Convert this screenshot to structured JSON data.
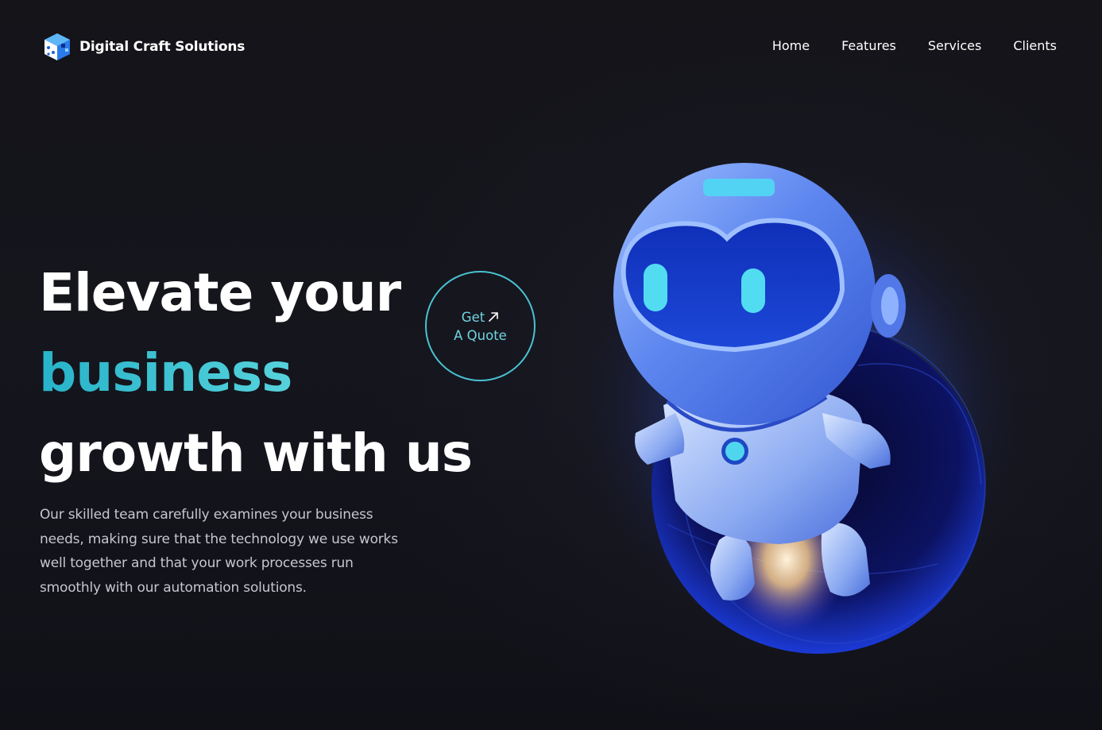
{
  "header": {
    "brand": "Digital Craft Solutions",
    "nav": [
      "Home",
      "Features",
      "Services",
      "Clients"
    ]
  },
  "hero": {
    "line1": "Elevate your",
    "line2": "business",
    "line3": "growth with us",
    "description": "Our skilled team carefully examines your business needs, making sure that the technology we use works well together and that your work processes run smoothly with our automation solutions.",
    "cta_line1": "Get",
    "cta_line2": "A Quote"
  },
  "colors": {
    "accent": "#49c3d3",
    "background": "#13131b",
    "robot_blue": "#3a6df0"
  },
  "icons": [
    "cube-logo-icon",
    "arrow-up-right-icon",
    "robot-illustration"
  ]
}
